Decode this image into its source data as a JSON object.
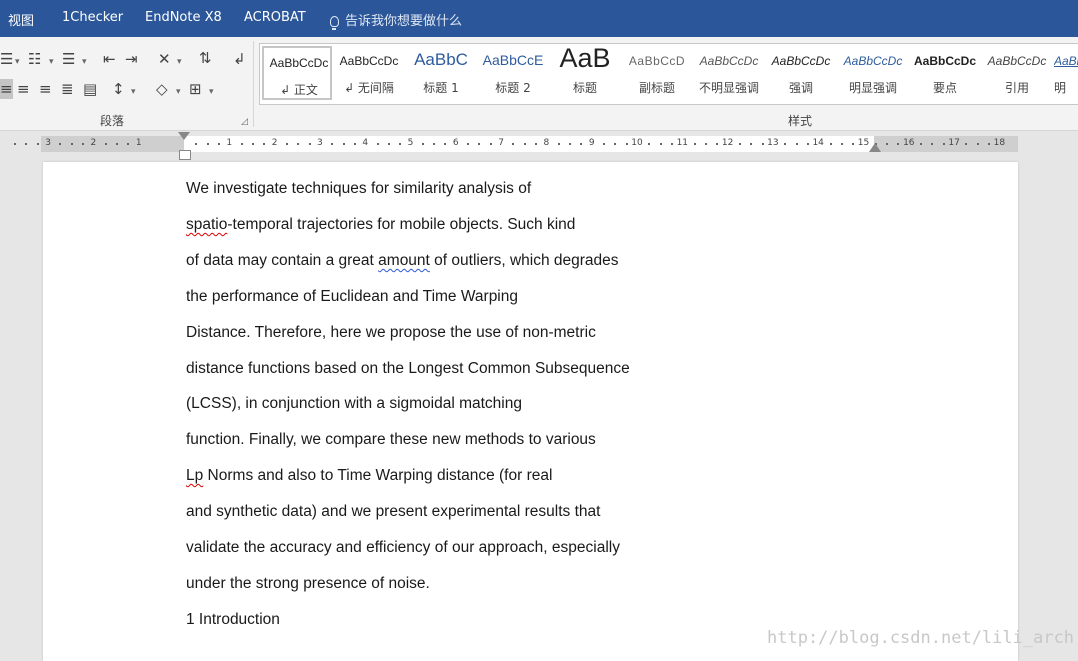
{
  "menu": {
    "items": [
      "视图",
      "1Checker",
      "EndNote X8",
      "ACROBAT"
    ],
    "tell_me": "告诉我你想要做什么"
  },
  "ribbon": {
    "paragraph_group_label": "段落",
    "styles_group_label": "样式",
    "styles": [
      {
        "sample": "AaBbCcDc",
        "name": "↲ 正文"
      },
      {
        "sample": "AaBbCcDc",
        "name": "↲ 无间隔"
      },
      {
        "sample": "AaBbC",
        "name": "标题 1"
      },
      {
        "sample": "AaBbCcE",
        "name": "标题 2"
      },
      {
        "sample": "AaB",
        "name": "标题"
      },
      {
        "sample": "AaBbCcD",
        "name": "副标题"
      },
      {
        "sample": "AaBbCcDc",
        "name": "不明显强调"
      },
      {
        "sample": "AaBbCcDc",
        "name": "强调"
      },
      {
        "sample": "AaBbCcDc",
        "name": "明显强调"
      },
      {
        "sample": "AaBbCcDc",
        "name": "要点"
      },
      {
        "sample": "AaBbCcDc",
        "name": "引用"
      },
      {
        "sample": "AaBl",
        "name": "明"
      }
    ]
  },
  "ruler": {
    "left_numbers": [
      "3",
      "2",
      "1"
    ],
    "right_numbers": [
      "1",
      "2",
      "3",
      "4",
      "5",
      "6",
      "7",
      "8",
      "9",
      "10",
      "11",
      "12",
      "13",
      "14",
      "15"
    ],
    "margin_numbers": [
      "16",
      "17",
      "18"
    ]
  },
  "document": {
    "lines": [
      [
        {
          "t": "We investigate techniques for similarity analysis of"
        }
      ],
      [
        {
          "t": "spatio",
          "sq": "red"
        },
        {
          "t": "-temporal trajectories for mobile objects. Such kind"
        }
      ],
      [
        {
          "t": "of data may contain a great "
        },
        {
          "t": "amount",
          "sq": "blue"
        },
        {
          "t": " of outliers, which degrades"
        }
      ],
      [
        {
          "t": "the performance of Euclidean and Time Warping"
        }
      ],
      [
        {
          "t": "Distance. Therefore, here we propose the use of non-metric"
        }
      ],
      [
        {
          "t": "distance functions based on the Longest Common Subsequence"
        }
      ],
      [
        {
          "t": "(LCSS), in conjunction with a sigmoidal matching"
        }
      ],
      [
        {
          "t": "function. Finally, we compare these new methods to various"
        }
      ],
      [
        {
          "t": "Lp",
          "sq": "red"
        },
        {
          "t": " Norms and also to Time Warping distance (for real"
        }
      ],
      [
        {
          "t": "and synthetic data) and we present experimental results that"
        }
      ],
      [
        {
          "t": "validate the accuracy and efficiency of our approach, especially"
        }
      ],
      [
        {
          "t": "under the strong presence of noise."
        }
      ],
      [
        {
          "t": "1 Introduction"
        }
      ]
    ]
  },
  "watermark": "http://blog.csdn.net/lili_arch"
}
